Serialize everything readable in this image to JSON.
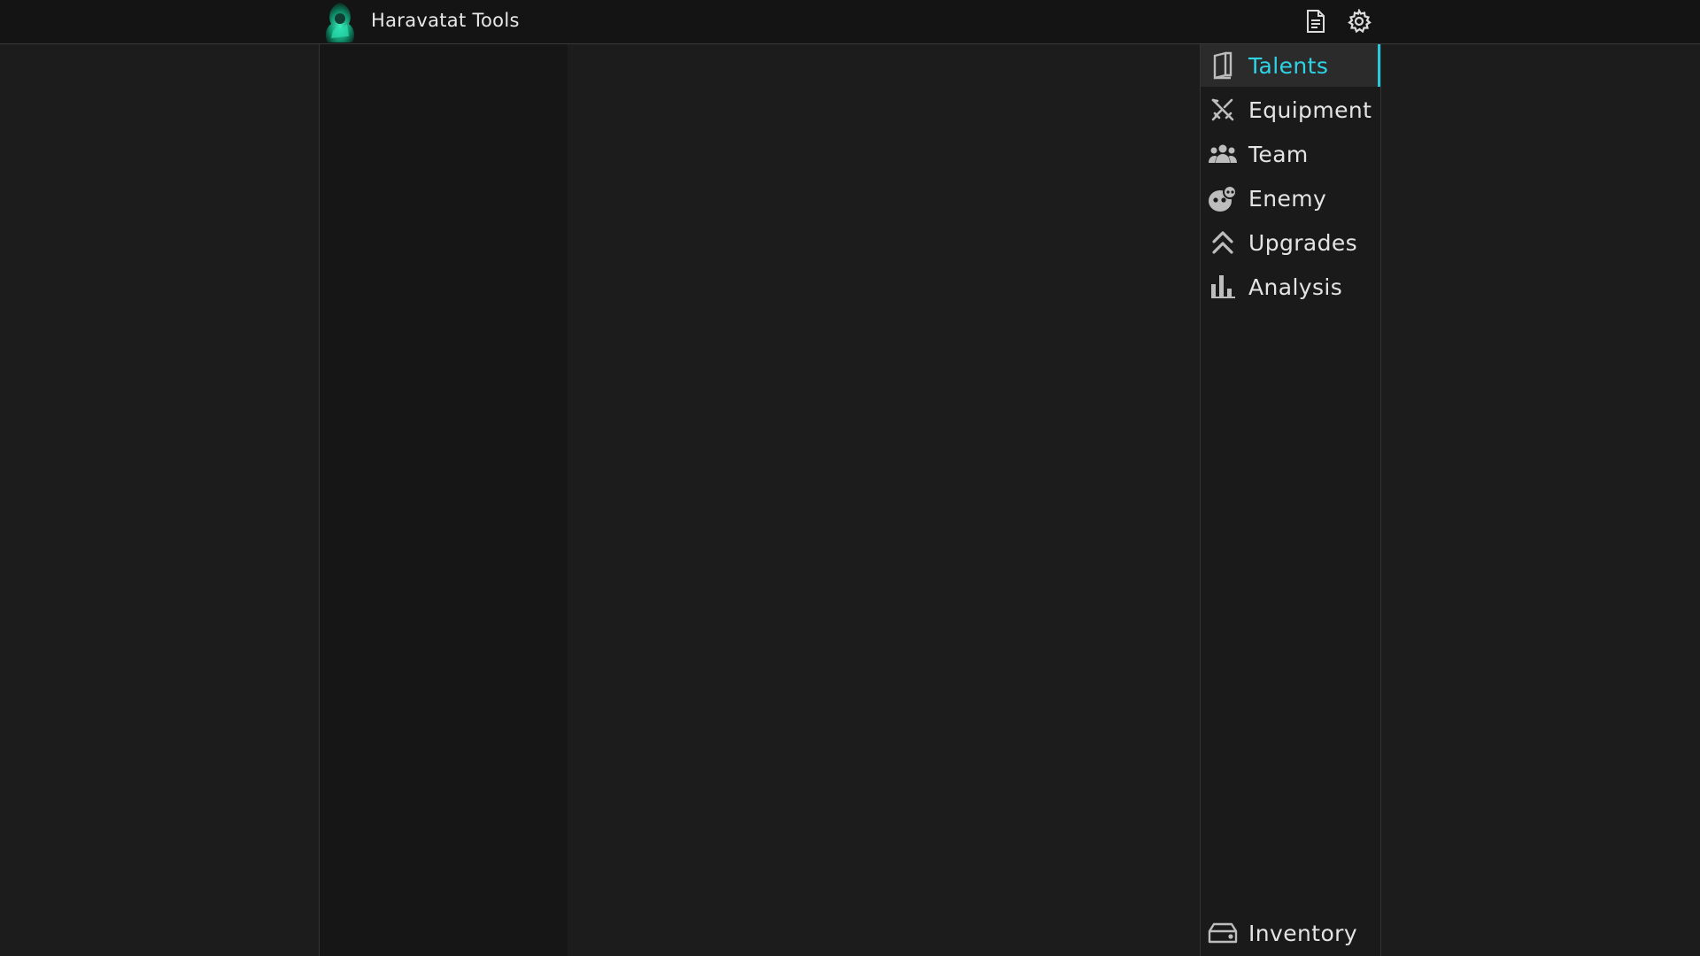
{
  "header": {
    "app_title": "Haravatat Tools",
    "logo_icon": "character-portrait-logo",
    "changelog_icon": "document-icon",
    "settings_icon": "gear-icon"
  },
  "nav": {
    "items": [
      {
        "label": "Talents",
        "icon": "book-icon",
        "active": true
      },
      {
        "label": "Equipment",
        "icon": "crossed-swords-icon",
        "active": false
      },
      {
        "label": "Team",
        "icon": "group-icon",
        "active": false
      },
      {
        "label": "Enemy",
        "icon": "enemy-face-icon",
        "active": false
      },
      {
        "label": "Upgrades",
        "icon": "double-chevron-up-icon",
        "active": false
      },
      {
        "label": "Analysis",
        "icon": "bar-chart-icon",
        "active": false
      }
    ],
    "inventory": {
      "label": "Inventory",
      "icon": "wallet-icon"
    }
  },
  "colors": {
    "accent": "#2ed3e6",
    "header_bg": "#141414",
    "page_bg": "#1c1c1c",
    "left_panel_bg": "#161616"
  }
}
